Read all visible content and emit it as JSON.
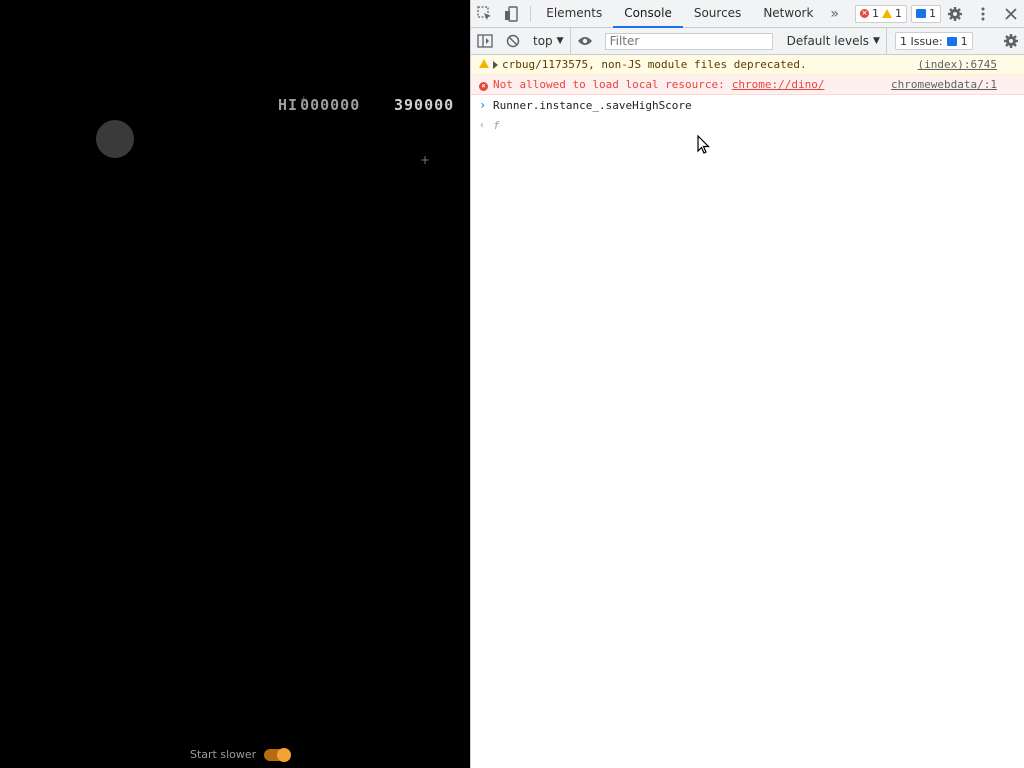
{
  "game": {
    "hi_label": "HI",
    "hi_score": "000000",
    "score": "390000",
    "start_slower_label": "Start slower",
    "start_slower_on": true
  },
  "devtools": {
    "tabs": [
      "Elements",
      "Console",
      "Sources",
      "Network"
    ],
    "active_tab": "Console",
    "error_count": "1",
    "warning_count": "1",
    "message_count": "1",
    "toolbar": {
      "context": "top",
      "filter_placeholder": "Filter",
      "levels": "Default levels",
      "issues_label": "1 Issue:",
      "issues_count": "1"
    },
    "console": [
      {
        "type": "warning",
        "text": "crbug/1173575, non-JS module files deprecated.",
        "source": "(index):6745"
      },
      {
        "type": "error",
        "text": "Not allowed to load local resource:",
        "link": "chrome://dino/",
        "source": "chromewebdata/:1"
      },
      {
        "type": "input",
        "text": "Runner.instance_.saveHighScore"
      },
      {
        "type": "result",
        "text": "f"
      }
    ]
  },
  "colors": {
    "accent": "#1a73e8",
    "error": "#e8453c",
    "warning": "#f2b600",
    "toggle": "#f3a233"
  }
}
